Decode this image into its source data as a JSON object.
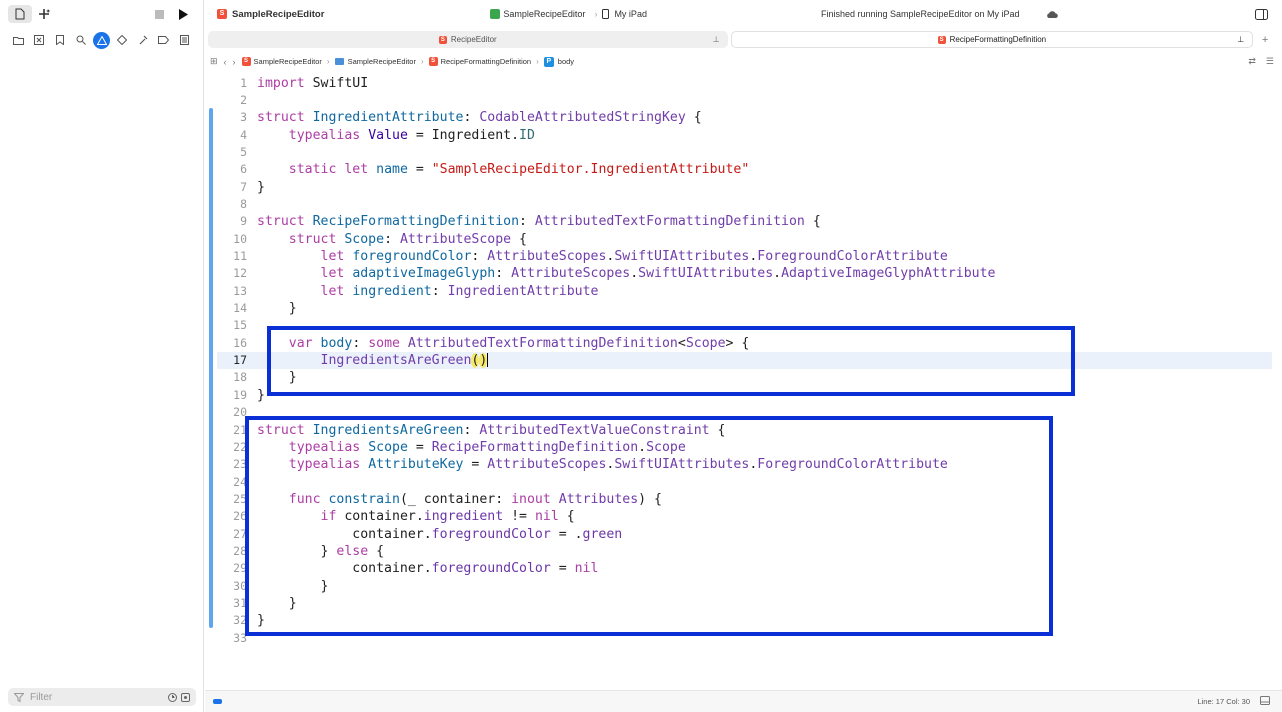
{
  "toolbar": {
    "project_title": "SampleRecipeEditor",
    "scheme": "SampleRecipeEditor",
    "destination": "My iPad",
    "status_text": "Finished running SampleRecipeEditor on My iPad"
  },
  "sidebar": {
    "filter_placeholder": "Filter"
  },
  "tabs": [
    {
      "label": "RecipeEditor"
    },
    {
      "label": "RecipeFormattingDefinition"
    }
  ],
  "jumpbar": {
    "items": [
      "SampleRecipeEditor",
      "SampleRecipeEditor",
      "RecipeFormattingDefinition",
      "body"
    ],
    "symbol_badge": "P"
  },
  "editor": {
    "current_line": 17,
    "lines": [
      {
        "n": "1"
      },
      {
        "n": "2"
      },
      {
        "n": "3"
      },
      {
        "n": "4"
      },
      {
        "n": "5"
      },
      {
        "n": "6"
      },
      {
        "n": "7"
      },
      {
        "n": "8"
      },
      {
        "n": "9"
      },
      {
        "n": "10"
      },
      {
        "n": "11"
      },
      {
        "n": "12"
      },
      {
        "n": "13"
      },
      {
        "n": "14"
      },
      {
        "n": "15"
      },
      {
        "n": "16"
      },
      {
        "n": "17"
      },
      {
        "n": "18"
      },
      {
        "n": "19"
      },
      {
        "n": "20"
      },
      {
        "n": "21"
      },
      {
        "n": "22"
      },
      {
        "n": "23"
      },
      {
        "n": "24"
      },
      {
        "n": "25"
      },
      {
        "n": "26"
      },
      {
        "n": "27"
      },
      {
        "n": "28"
      },
      {
        "n": "29"
      },
      {
        "n": "30"
      },
      {
        "n": "31"
      },
      {
        "n": "32"
      },
      {
        "n": "33"
      }
    ],
    "tokens": {
      "l1": [
        "import",
        " SwiftUI"
      ],
      "l3": [
        "struct",
        " ",
        "IngredientAttribute",
        ": ",
        "CodableAttributedStringKey",
        " {"
      ],
      "l4": [
        "    ",
        "typealias",
        " ",
        "Value",
        " = Ingredient.",
        "ID"
      ],
      "l6": [
        "    ",
        "static",
        " ",
        "let",
        " ",
        "name",
        " = ",
        "\"SampleRecipeEditor.IngredientAttribute\""
      ],
      "l7": [
        "}"
      ],
      "l9": [
        "struct",
        " ",
        "RecipeFormattingDefinition",
        ": ",
        "AttributedTextFormattingDefinition",
        " {"
      ],
      "l10": [
        "    ",
        "struct",
        " ",
        "Scope",
        ": ",
        "AttributeScope",
        " {"
      ],
      "l11": [
        "        ",
        "let",
        " ",
        "foregroundColor",
        ": ",
        "AttributeScopes",
        ".",
        "SwiftUIAttributes",
        ".",
        "ForegroundColorAttribute"
      ],
      "l12": [
        "        ",
        "let",
        " ",
        "adaptiveImageGlyph",
        ": ",
        "AttributeScopes",
        ".",
        "SwiftUIAttributes",
        ".",
        "AdaptiveImageGlyphAttribute"
      ],
      "l13": [
        "        ",
        "let",
        " ",
        "ingredient",
        ": ",
        "IngredientAttribute"
      ],
      "l14": [
        "    }"
      ],
      "l16": [
        "    ",
        "var",
        " ",
        "body",
        ": ",
        "some",
        " ",
        "AttributedTextFormattingDefinition",
        "<",
        "Scope",
        "> {"
      ],
      "l17": [
        "        ",
        "IngredientsAreGreen",
        "(",
        ")"
      ],
      "l18": [
        "    }"
      ],
      "l19": [
        "}"
      ],
      "l21": [
        "struct",
        " ",
        "IngredientsAreGreen",
        ": ",
        "AttributedTextValueConstraint",
        " {"
      ],
      "l22": [
        "    ",
        "typealias",
        " ",
        "Scope",
        " = ",
        "RecipeFormattingDefinition",
        ".",
        "Scope"
      ],
      "l23": [
        "    ",
        "typealias",
        " ",
        "AttributeKey",
        " = ",
        "AttributeScopes",
        ".",
        "SwiftUIAttributes",
        ".",
        "ForegroundColorAttribute"
      ],
      "l25": [
        "    ",
        "func",
        " ",
        "constrain",
        "(_ container: ",
        "inout",
        " ",
        "Attributes",
        ") {"
      ],
      "l26": [
        "        ",
        "if",
        " container.",
        "ingredient",
        " != ",
        "nil",
        " {"
      ],
      "l27": [
        "            container.",
        "foregroundColor",
        " = .",
        "green"
      ],
      "l28": [
        "        } ",
        "else",
        " {"
      ],
      "l29": [
        "            container.",
        "foregroundColor",
        " = ",
        "nil"
      ],
      "l30": [
        "        }"
      ],
      "l31": [
        "    }"
      ],
      "l32": [
        "}"
      ]
    }
  },
  "status": {
    "position": "Line: 17  Col: 30"
  },
  "colors": {
    "annotation_box": "#0b2fd6",
    "keyword": "#ad3da4",
    "type": "#703daa",
    "string": "#c41a16",
    "property": "#326d74"
  }
}
